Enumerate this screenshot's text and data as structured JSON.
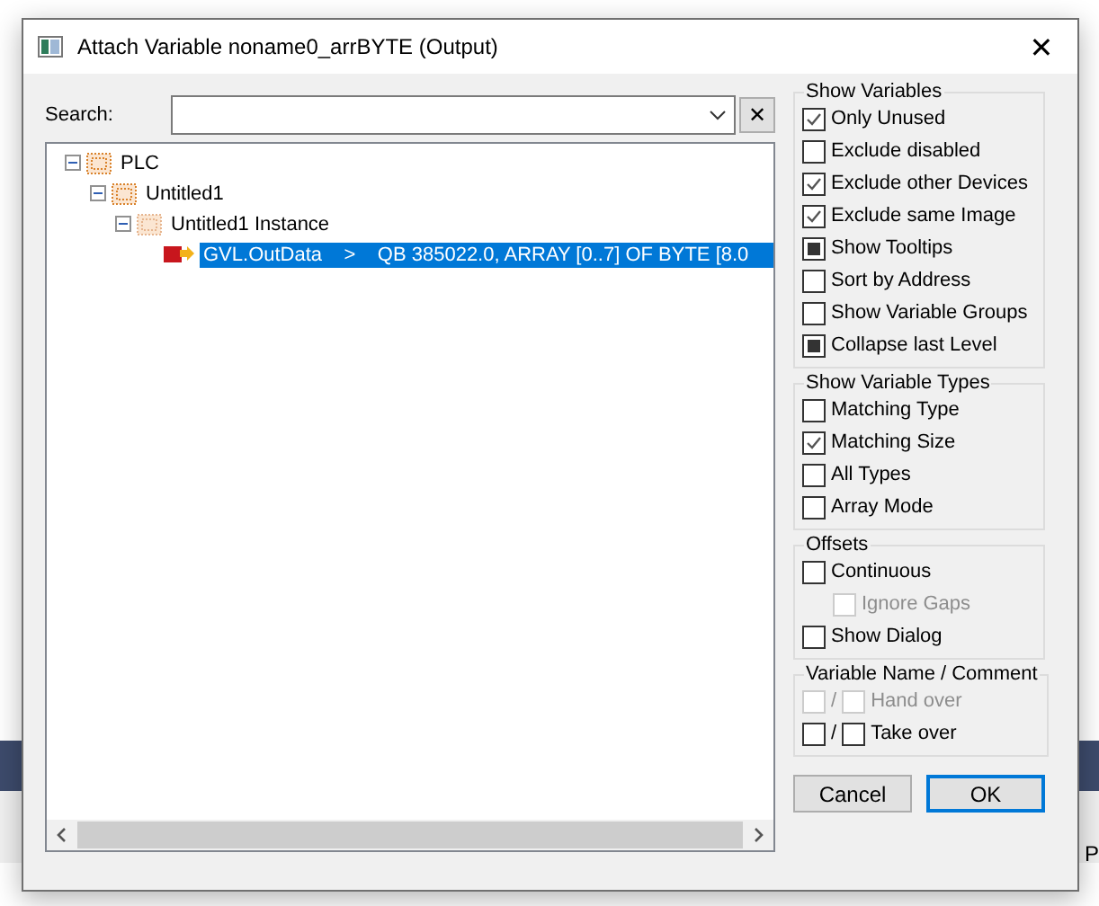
{
  "window": {
    "title": "Attach Variable noname0_arrBYTE (Output)",
    "close": "✕"
  },
  "search": {
    "label": "Search:",
    "clear": "✕"
  },
  "tree": [
    {
      "label": "PLC",
      "expanded": true,
      "children": [
        {
          "label": "Untitled1",
          "expanded": true,
          "children": [
            {
              "label": "Untitled1 Instance",
              "expanded": true,
              "kind": "instance",
              "children": [
                {
                  "label": "GVL.OutData    >    QB 385022.0, ARRAY [0..7] OF BYTE [8.0",
                  "kind": "variable",
                  "selected": true
                }
              ]
            }
          ]
        }
      ]
    }
  ],
  "groups": [
    {
      "title": "Show Variables",
      "options": [
        {
          "label": "Only Unused",
          "checked": true,
          "mixed": false,
          "disabled": false
        },
        {
          "label": "Exclude disabled",
          "checked": false,
          "mixed": false,
          "disabled": false
        },
        {
          "label": "Exclude other Devices",
          "checked": true,
          "mixed": false,
          "disabled": false
        },
        {
          "label": "Exclude same Image",
          "checked": true,
          "mixed": false,
          "disabled": false
        },
        {
          "label": "Show Tooltips",
          "checked": false,
          "mixed": true,
          "disabled": false
        },
        {
          "label": "Sort by Address",
          "checked": false,
          "mixed": false,
          "disabled": false
        },
        {
          "label": "Show Variable Groups",
          "checked": false,
          "mixed": false,
          "disabled": false
        },
        {
          "label": "Collapse last Level",
          "checked": false,
          "mixed": true,
          "disabled": false
        }
      ]
    },
    {
      "title": "Show Variable Types",
      "options": [
        {
          "label": "Matching Type",
          "checked": false,
          "mixed": false,
          "disabled": false
        },
        {
          "label": "Matching Size",
          "checked": true,
          "mixed": false,
          "disabled": false
        },
        {
          "label": "All Types",
          "checked": false,
          "mixed": false,
          "disabled": false
        },
        {
          "label": "Array Mode",
          "checked": false,
          "mixed": false,
          "disabled": false
        }
      ]
    },
    {
      "title": "Offsets",
      "options": [
        {
          "label": "Continuous",
          "checked": false,
          "mixed": false,
          "disabled": false
        },
        {
          "label": "Ignore Gaps",
          "checked": false,
          "mixed": false,
          "disabled": true,
          "kind": "sub"
        },
        {
          "label": "Show Dialog",
          "checked": false,
          "mixed": false,
          "disabled": false
        }
      ]
    }
  ],
  "name_comment": {
    "title": "Variable Name / Comment",
    "rows": [
      {
        "label": "Hand over",
        "separator": "/",
        "disabled": true,
        "name_checked": false,
        "comment_checked": false
      },
      {
        "label": "Take over",
        "separator": "/",
        "disabled": false,
        "name_checked": false,
        "comment_checked": false
      }
    ]
  },
  "buttons": [
    {
      "label": "Cancel",
      "default": false
    },
    {
      "label": "OK",
      "default": true
    }
  ],
  "background_text": "P"
}
